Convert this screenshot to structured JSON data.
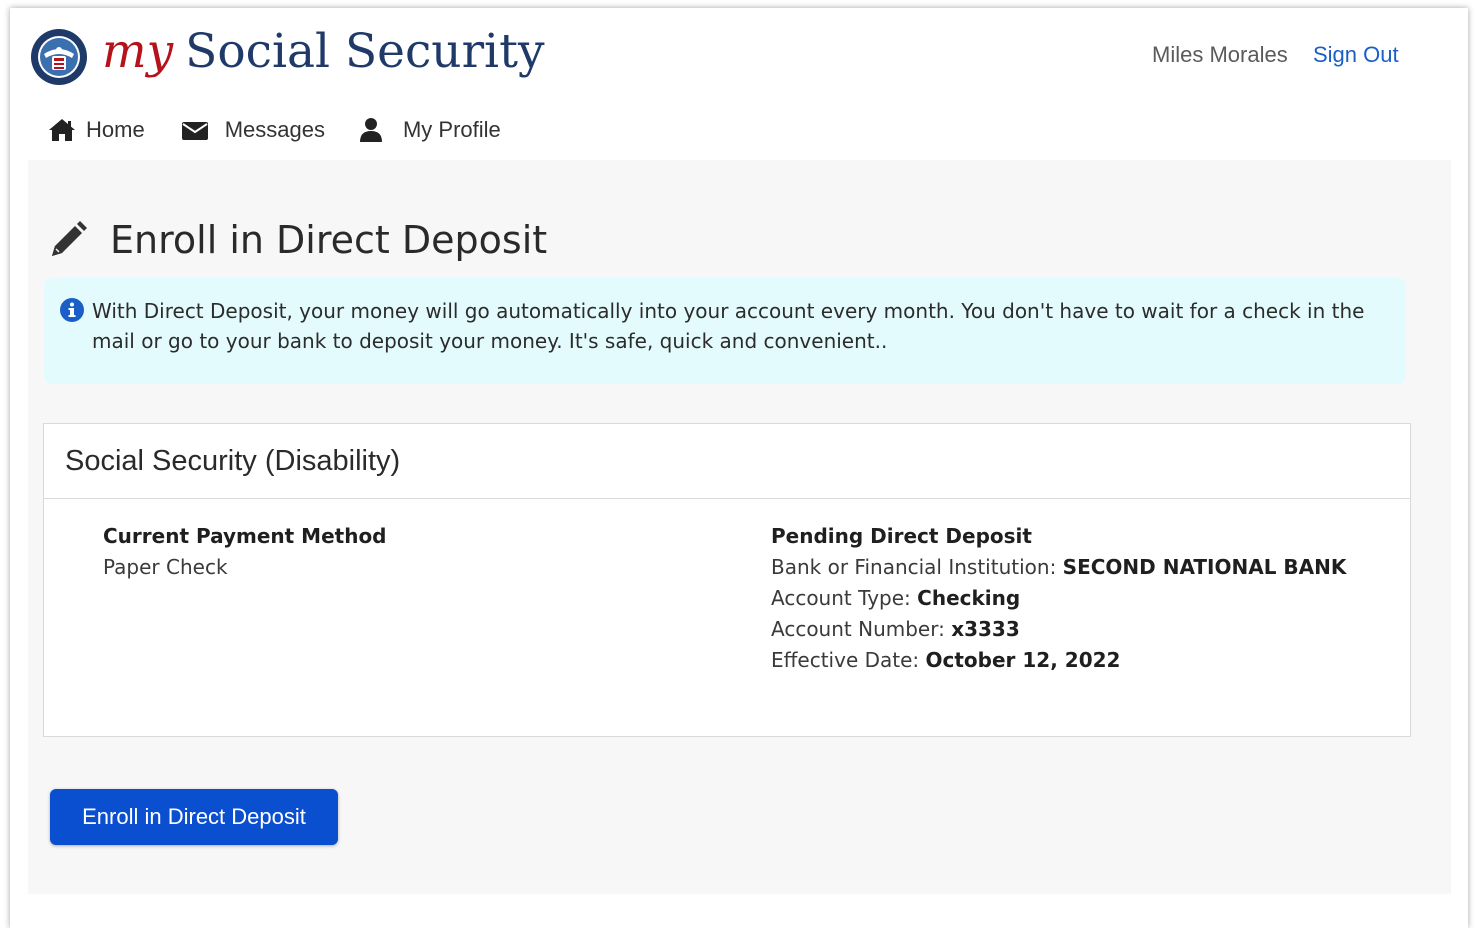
{
  "header": {
    "brand_my": "my",
    "brand_name": "Social Security",
    "user_name": "Miles Morales",
    "sign_out": "Sign Out"
  },
  "nav": [
    {
      "label": "Home",
      "icon": "home-icon"
    },
    {
      "label": "Messages",
      "icon": "envelope-icon"
    },
    {
      "label": "My Profile",
      "icon": "user-icon"
    }
  ],
  "page": {
    "title": "Enroll in Direct Deposit",
    "title_icon": "pencil-icon"
  },
  "info": {
    "icon": "info-icon",
    "text": "With Direct Deposit, your money will go automatically into your account every month. You don't have to wait for a check in the mail or go to your bank to deposit your money. It's safe, quick and convenient.."
  },
  "card": {
    "title": "Social Security (Disability)",
    "current": {
      "heading": "Current Payment Method",
      "value": "Paper Check"
    },
    "pending": {
      "heading": "Pending Direct Deposit",
      "bank_label": "Bank or Financial Institution:",
      "bank_value": "SECOND NATIONAL BANK",
      "type_label": "Account Type:",
      "type_value": "Checking",
      "number_label": "Account Number:",
      "number_value": "x3333",
      "date_label": "Effective Date:",
      "date_value": "October 12, 2022"
    }
  },
  "actions": {
    "enroll_label": "Enroll in Direct Deposit"
  },
  "colors": {
    "brand_red": "#b5121b",
    "brand_navy": "#1f3a68",
    "link_blue": "#1a5fc8",
    "button_blue": "#0b4fd1",
    "info_bg": "#e3fbfd",
    "info_icon": "#1a5fc8"
  }
}
